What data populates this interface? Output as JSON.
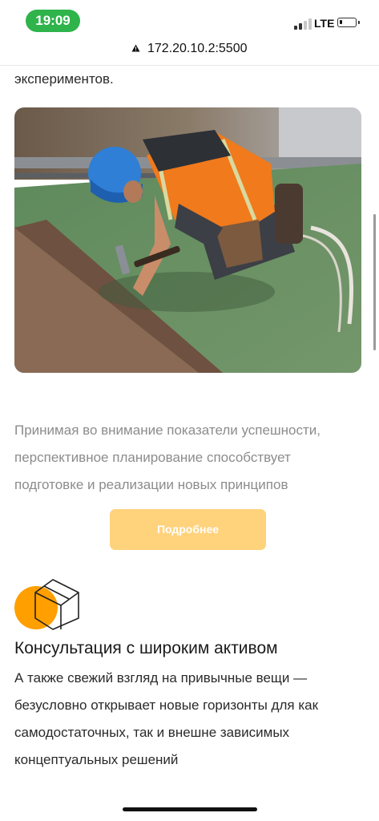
{
  "status_bar": {
    "time": "19:09",
    "network": "LTE",
    "battery_level": 0.15,
    "signal_bars": 2
  },
  "browser": {
    "url": "172.20.10.2:5500",
    "warning_icon": "warning-triangle-icon"
  },
  "content": {
    "top_text": "экспериментов.",
    "image": {
      "icon": "construction-worker-photo"
    },
    "paragraph_lines": [
      "Принимая во внимание показатели успешности,",
      "перспективное планирование способствует",
      "подготовке и реализации новых принципов"
    ],
    "button_label": "Подробнее",
    "feature": {
      "icon": "cube-orange-circle-icon",
      "title": "Консультация с широким активом",
      "text_lines": [
        "А также свежий взгляд на привычные вещи —",
        "безусловно открывает новые горизонты для как",
        "самодостаточных, так и внешне зависимых",
        "концептуальных решений"
      ]
    }
  },
  "colors": {
    "accent": "#ff9f00",
    "button": "#ffd27c",
    "status_pill": "#2fb34b",
    "muted_text": "#8c8c8c"
  }
}
